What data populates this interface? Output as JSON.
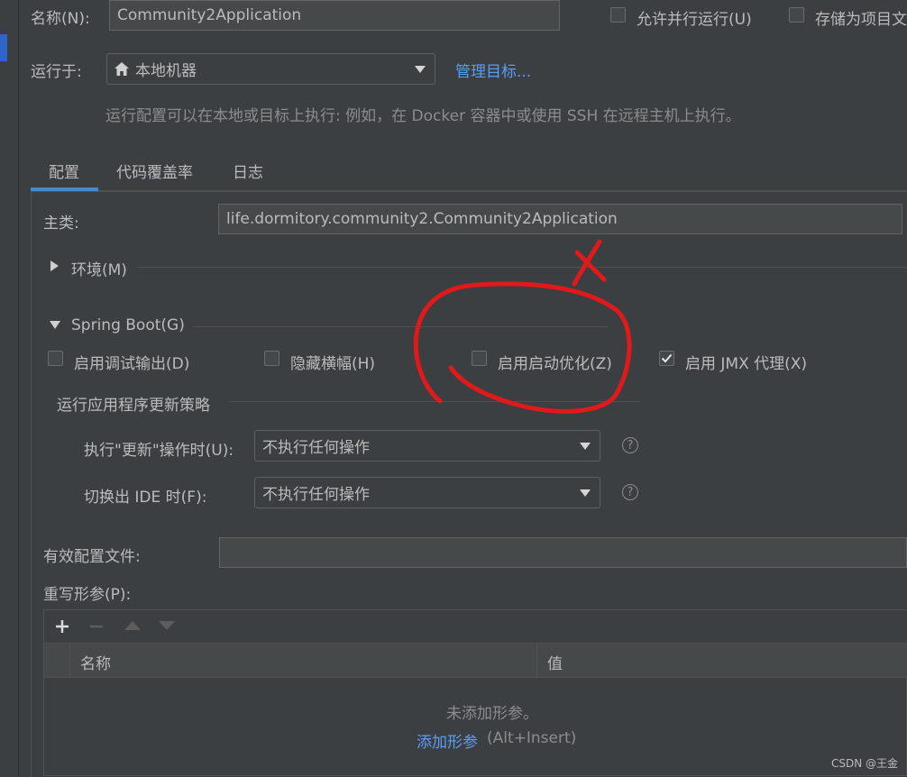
{
  "name_label": "名称(N):",
  "name_value": "Community2Application",
  "allow_parallel": "允许并行运行(U)",
  "store_as_project": "存储为项目文",
  "run_on_label": "运行于:",
  "run_on_value": "本地机器",
  "manage_targets": "管理目标...",
  "run_on_hint": "运行配置可以在本地或目标上执行: 例如，在 Docker 容器中或使用 SSH 在远程主机上执行。",
  "tabs": [
    "配置",
    "代码覆盖率",
    "日志"
  ],
  "main_class_label": "主类:",
  "main_class_value": "life.dormitory.community2.Community2Application",
  "env_section": "环境(M)",
  "spring_boot_section": "Spring Boot(G)",
  "checkboxes": {
    "debug_output": "启用调试输出(D)",
    "hide_banner": "隐藏横幅(H)",
    "launch_optimization": "启用启动优化(Z)",
    "jmx_agent": "启用 JMX 代理(X)"
  },
  "update_policy_section": "运行应用程序更新策略",
  "on_update_label": "执行\"更新\"操作时(U):",
  "on_update_value": "不执行任何操作",
  "on_frame_label": "切换出 IDE 时(F):",
  "on_frame_value": "不执行任何操作",
  "active_profiles_label": "有效配置文件:",
  "override_params_label": "重写形参(P):",
  "table": {
    "col_name": "名称",
    "col_value": "值",
    "empty_text": "未添加形参。",
    "add_link": "添加形参",
    "add_shortcut": "(Alt+Insert)"
  },
  "annotation_mark": "X",
  "watermark": "CSDN @王金",
  "colors": {
    "accent": "#4a88c7",
    "link": "#589df6",
    "annotation": "#e0191b"
  }
}
